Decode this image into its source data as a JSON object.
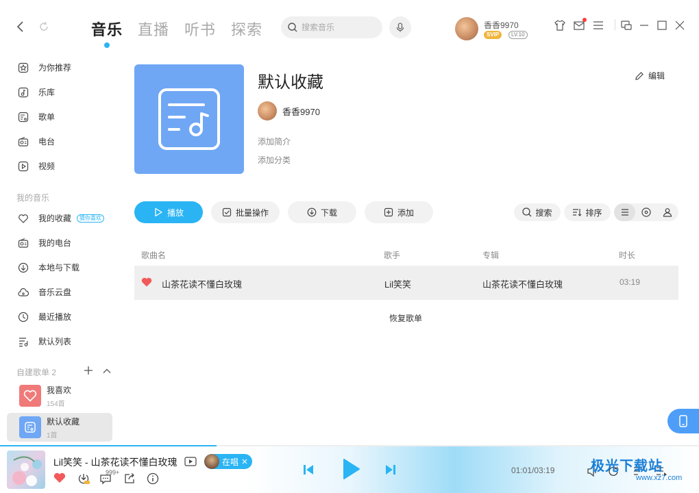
{
  "header": {
    "tabs": [
      "音乐",
      "直播",
      "听书",
      "探索"
    ],
    "active_tab": 0,
    "search_placeholder": "搜索音乐",
    "user": {
      "name": "香香9970",
      "vip": "SVIP",
      "level": "LV.10"
    }
  },
  "sidebar": {
    "items": [
      {
        "label": "为你推荐",
        "icon": "star-icon"
      },
      {
        "label": "乐库",
        "icon": "music-note-icon"
      },
      {
        "label": "歌单",
        "icon": "playlist-icon"
      },
      {
        "label": "电台",
        "icon": "radio-icon"
      },
      {
        "label": "视频",
        "icon": "video-icon"
      }
    ],
    "my_music_title": "我的音乐",
    "my_music": [
      {
        "label": "我的收藏",
        "icon": "heart-icon",
        "badge": "猜你喜欢"
      },
      {
        "label": "我的电台",
        "icon": "radio-icon"
      },
      {
        "label": "本地与下载",
        "icon": "download-icon"
      },
      {
        "label": "音乐云盘",
        "icon": "cloud-icon"
      },
      {
        "label": "最近播放",
        "icon": "clock-icon"
      },
      {
        "label": "默认列表",
        "icon": "list-icon"
      }
    ],
    "created_title": "自建歌单 2",
    "playlists": [
      {
        "title": "我喜欢",
        "count": "154首",
        "color": "#f07a7a"
      },
      {
        "title": "默认收藏",
        "count": "1首",
        "color": "#6fa7f5"
      }
    ]
  },
  "playlist": {
    "title": "默认收藏",
    "owner": "香香9970",
    "add_intro": "添加简介",
    "add_category": "添加分类",
    "edit_label": "编辑",
    "actions": {
      "play": "播放",
      "batch": "批量操作",
      "download": "下载",
      "add": "添加"
    },
    "tools": {
      "search": "搜索",
      "sort": "排序"
    }
  },
  "table": {
    "headers": {
      "song": "歌曲名",
      "artist": "歌手",
      "album": "专辑",
      "duration": "时长"
    },
    "rows": [
      {
        "song": "山茶花读不懂白玫瑰",
        "artist": "Lil笑笑",
        "album": "山茶花读不懂白玫瑰",
        "duration": "03:19",
        "liked": true
      }
    ],
    "restore_label": "恢复歌单"
  },
  "player": {
    "now_playing": "Lil笑笑 - 山茶花读不懂白玫瑰",
    "singer_status": "在唱",
    "comment_count": "999+",
    "time": "01:01/03:19",
    "progress": 0.31,
    "watermark": "极光下载站",
    "watermark_url": "www.xz7.com"
  },
  "colors": {
    "accent": "#2ab4f4",
    "cover": "#6fa7f5",
    "heart": "#f25a5a"
  }
}
